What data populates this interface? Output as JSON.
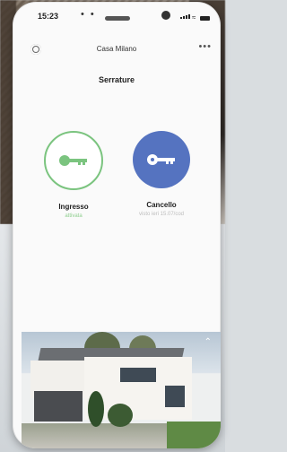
{
  "status_bar": {
    "time": "15:23"
  },
  "header": {
    "title": "Casa Milano",
    "more_label": "•••"
  },
  "section_title": "Serrature",
  "locks": [
    {
      "name": "Ingresso",
      "status": "attivata",
      "accent": "#7bc47f"
    },
    {
      "name": "Cancello",
      "status": "visto ieri 15.07/cod",
      "accent": "#5573c0"
    }
  ],
  "icons": {
    "settings": "gear-icon",
    "more": "more-icon",
    "key": "key-icon",
    "expand": "chevron-up-icon"
  }
}
